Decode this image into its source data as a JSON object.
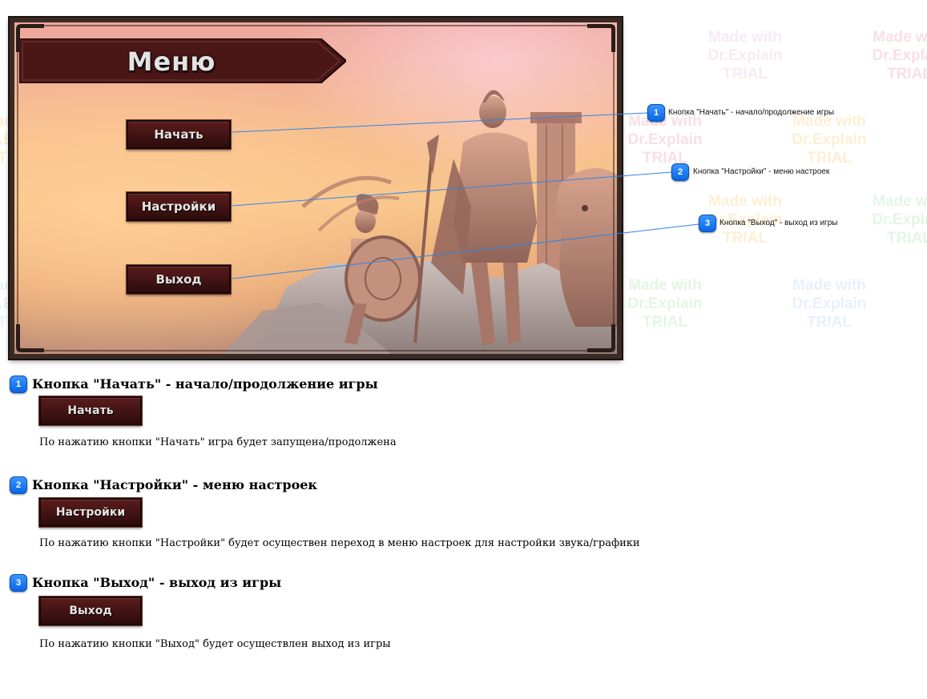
{
  "watermark": {
    "lines": [
      "Made with",
      "Dr.Explain",
      "TRIAL"
    ],
    "colors": [
      "#f5c6cf",
      "#fce2b0",
      "#cfeecf",
      "#d7e4fa",
      "#f2d9ee"
    ]
  },
  "game": {
    "menu_title": "Меню",
    "buttons": {
      "start": "Начать",
      "settings": "Настройки",
      "exit": "Выход"
    }
  },
  "callouts": [
    {
      "number": "1",
      "text": "Кнопка \"Начать\" - начало/продолжение игры"
    },
    {
      "number": "2",
      "text": "Кнопка \"Настройки\" - меню настроек"
    },
    {
      "number": "3",
      "text": "Кнопка \"Выход\" - выход из игры"
    }
  ],
  "sections": [
    {
      "number": "1",
      "heading": "Кнопка \"Начать\" - начало/продолжение игры",
      "button": "Начать",
      "description": "По нажатию кнопки \"Начать\" игра будет запущена/продолжена"
    },
    {
      "number": "2",
      "heading": "Кнопка \"Настройки\" - меню настроек",
      "button": "Настройки",
      "description": "По нажатию кнопки \"Настройки\" будет осуществен переход в меню настроек для настройки звука/графики"
    },
    {
      "number": "3",
      "heading": "Кнопка \"Выход\" - выход из игры",
      "button": "Выход",
      "description": "По нажатию кнопки \"Выход\" будет осуществлен выход из игры"
    }
  ],
  "colors": {
    "callout_badge": "#0a66e6",
    "callout_line": "#2f86e8",
    "menu_button": "#431414",
    "frame": "#3a2a24"
  }
}
